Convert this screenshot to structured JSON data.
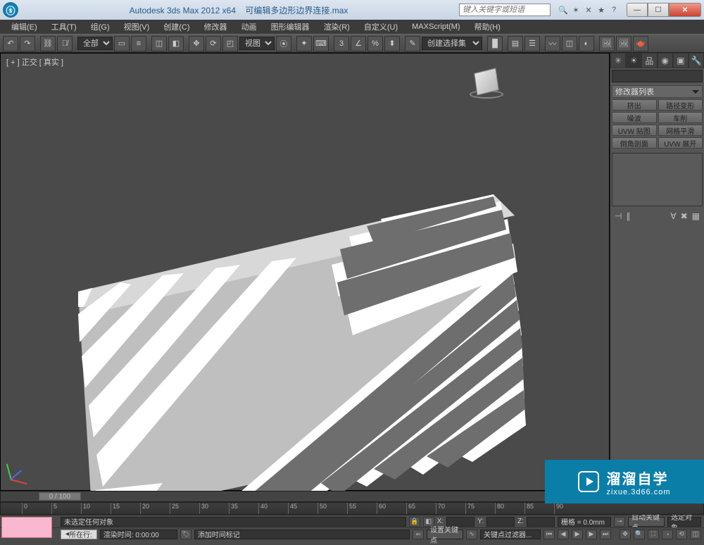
{
  "title": {
    "app": "Autodesk 3ds Max  2012 x64",
    "file": "可编辑多边形边界连接.max",
    "search_placeholder": "键入关键字或短语"
  },
  "menus": [
    "编辑(E)",
    "工具(T)",
    "组(G)",
    "视图(V)",
    "创建(C)",
    "修改器",
    "动画",
    "图形编辑器",
    "渲染(R)",
    "自定义(U)",
    "MAXScript(M)",
    "帮助(H)"
  ],
  "toolbar": {
    "scope": "全部",
    "view": "视图",
    "num3": "3",
    "selectset": "创建选择集"
  },
  "viewport": {
    "label": "[ + ] 正交 [ 真实 ]"
  },
  "cmdpanel": {
    "modifier_list": "修改器列表",
    "mods": [
      "挤出",
      "路径变形",
      "噪波",
      "车削",
      "UVW 贴图",
      "网格平滑",
      "倒角剖面",
      "UVW 展开"
    ]
  },
  "timeline": {
    "frame_label": "0 / 100",
    "ticks": [
      0,
      5,
      10,
      15,
      20,
      25,
      30,
      35,
      40,
      45,
      50,
      55,
      60,
      65,
      70,
      75,
      80,
      85,
      90
    ]
  },
  "status": {
    "no_selection": "未选定任何对象",
    "x": "X:",
    "y": "Y:",
    "z": "Z:",
    "grid": "栅格 = 0.0mm",
    "autokey": "自动关键点",
    "selkey": "选定对象",
    "row2_label": "所在行:",
    "render_time": "渲染时间: 0:00:00",
    "add_time_tag": "添加时间标记",
    "setkey": "设置关键点",
    "keyfilter": "关键点过滤器..."
  },
  "watermark": {
    "brand": "溜溜自学",
    "url": "zixue.3d66.com"
  }
}
